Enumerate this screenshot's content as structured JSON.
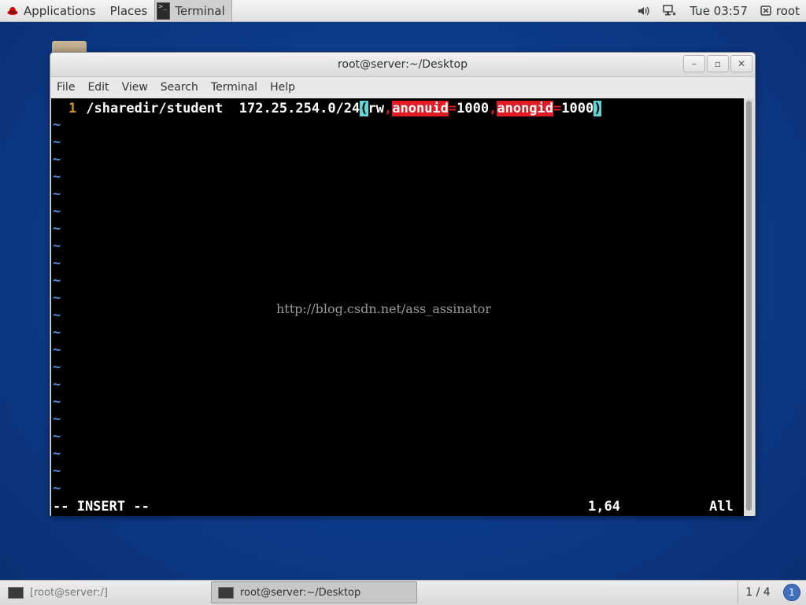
{
  "top_panel": {
    "applications": "Applications",
    "places": "Places",
    "active_app": "Terminal",
    "clock": "Tue 03:57",
    "user": "root"
  },
  "window": {
    "title": "root@server:~/Desktop",
    "menu": [
      "File",
      "Edit",
      "View",
      "Search",
      "Terminal",
      "Help"
    ]
  },
  "editor": {
    "line_number": "1",
    "path": "/sharedir/student",
    "network": "172.25.254.0/24",
    "paren_open": "(",
    "opt_rw": "rw",
    "comma1": ",",
    "key1": "anonuid",
    "eq1": "=",
    "val1": "1000",
    "comma2": ",",
    "key2": "anongid",
    "eq2": "=",
    "val2": "1000",
    "paren_close": ")",
    "empty_line_marker": "~",
    "mode": "-- INSERT --",
    "cursor_pos": "1,64",
    "scroll_pos": "All",
    "watermark": "http://blog.csdn.net/ass_assinator"
  },
  "taskbar": {
    "task1": "[root@server:/]",
    "task2": "root@server:~/Desktop",
    "workspace": "1 / 4",
    "notifications": "1"
  },
  "colors": {
    "desktop": "#0d3a88",
    "line_number": "#d28b26",
    "tilde": "#4f8dd6",
    "highlight_paren": "#5fd7d7",
    "highlight_error": "#e01b24"
  }
}
